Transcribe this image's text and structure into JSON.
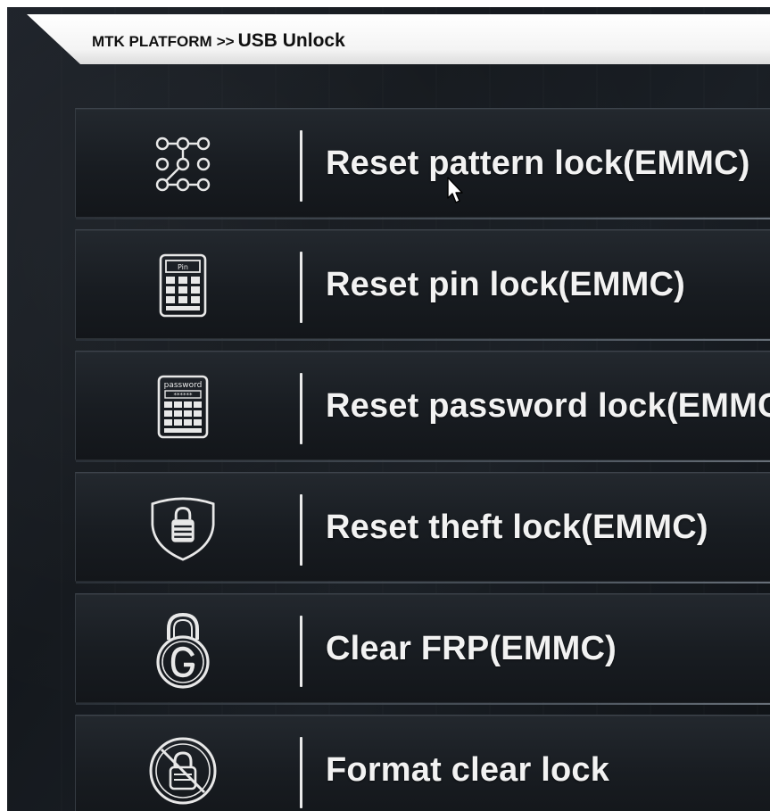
{
  "header": {
    "parent": "MTK PLATFORM",
    "separator": ">>",
    "current": "USB Unlock"
  },
  "menu": {
    "items": [
      {
        "label": "Reset pattern lock(EMMC)",
        "icon": "pattern-lock-icon"
      },
      {
        "label": "Reset pin lock(EMMC)",
        "icon": "pin-keypad-icon"
      },
      {
        "label": "Reset password lock(EMMC)",
        "icon": "password-keypad-icon"
      },
      {
        "label": "Reset theft lock(EMMC)",
        "icon": "shield-lock-icon"
      },
      {
        "label": "Clear FRP(EMMC)",
        "icon": "google-lock-icon"
      },
      {
        "label": "Format clear lock",
        "icon": "no-lock-icon"
      }
    ],
    "icon_texts": {
      "pin_screen": "Pin",
      "password_screen": "password",
      "password_field": "******"
    }
  },
  "colors": {
    "background": "#161a1f",
    "item_text": "#f2f2f2",
    "header_bg": "#ffffff",
    "header_text": "#111111"
  }
}
